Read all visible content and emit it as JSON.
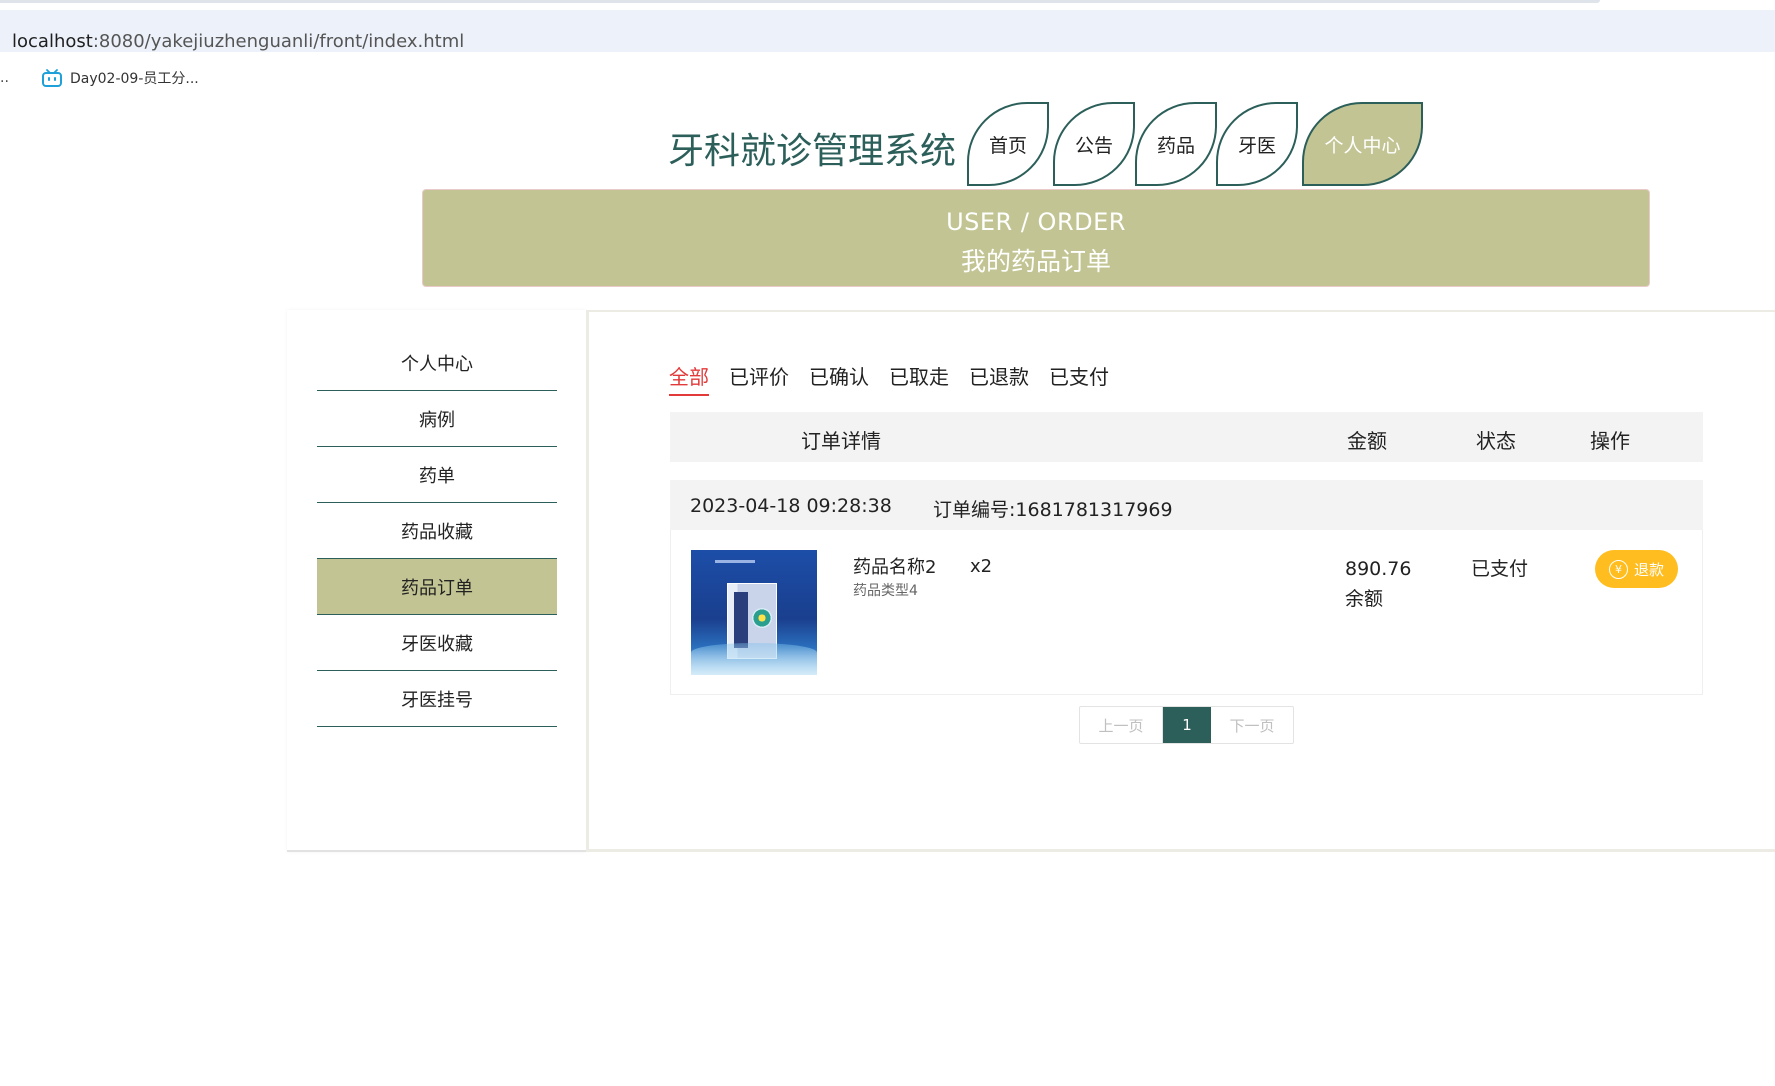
{
  "browser": {
    "url_host": "localhost",
    "url_rest": ":8080/yakejiuzhenguanli/front/index.html",
    "bookmark_overflow": "..",
    "bookmark_label": "Day02-09-员工分..."
  },
  "header": {
    "site_title": "牙科就诊管理系统",
    "nav": [
      "首页",
      "公告",
      "药品",
      "牙医",
      "个人中心"
    ],
    "active_nav": "个人中心"
  },
  "banner": {
    "title_en": "USER / ORDER",
    "title_cn": "我的药品订单"
  },
  "sidebar": {
    "items": [
      "个人中心",
      "病例",
      "药单",
      "药品收藏",
      "药品订单",
      "牙医收藏",
      "牙医挂号"
    ],
    "active": "药品订单"
  },
  "status_tabs": {
    "items": [
      "全部",
      "已评价",
      "已确认",
      "已取走",
      "已退款",
      "已支付"
    ],
    "active": "全部"
  },
  "table": {
    "headers": {
      "detail": "订单详情",
      "amount": "金额",
      "status": "状态",
      "action": "操作"
    }
  },
  "order": {
    "time": "2023-04-18 09:28:38",
    "number_label": "订单编号:1681781317969",
    "product_name": "药品名称2",
    "product_type": "药品类型4",
    "quantity": "x2",
    "amount": "890.76",
    "pay_method": "余额",
    "status": "已支付",
    "refund_icon": "¥",
    "refund_label": "退款"
  },
  "pagination": {
    "prev": "上一页",
    "current": "1",
    "next": "下一页"
  },
  "colors": {
    "theme_green": "#2c5f5a",
    "olive": "#c2c593",
    "active_red": "#e23a3a",
    "refund_yellow": "#ffbd1f"
  }
}
